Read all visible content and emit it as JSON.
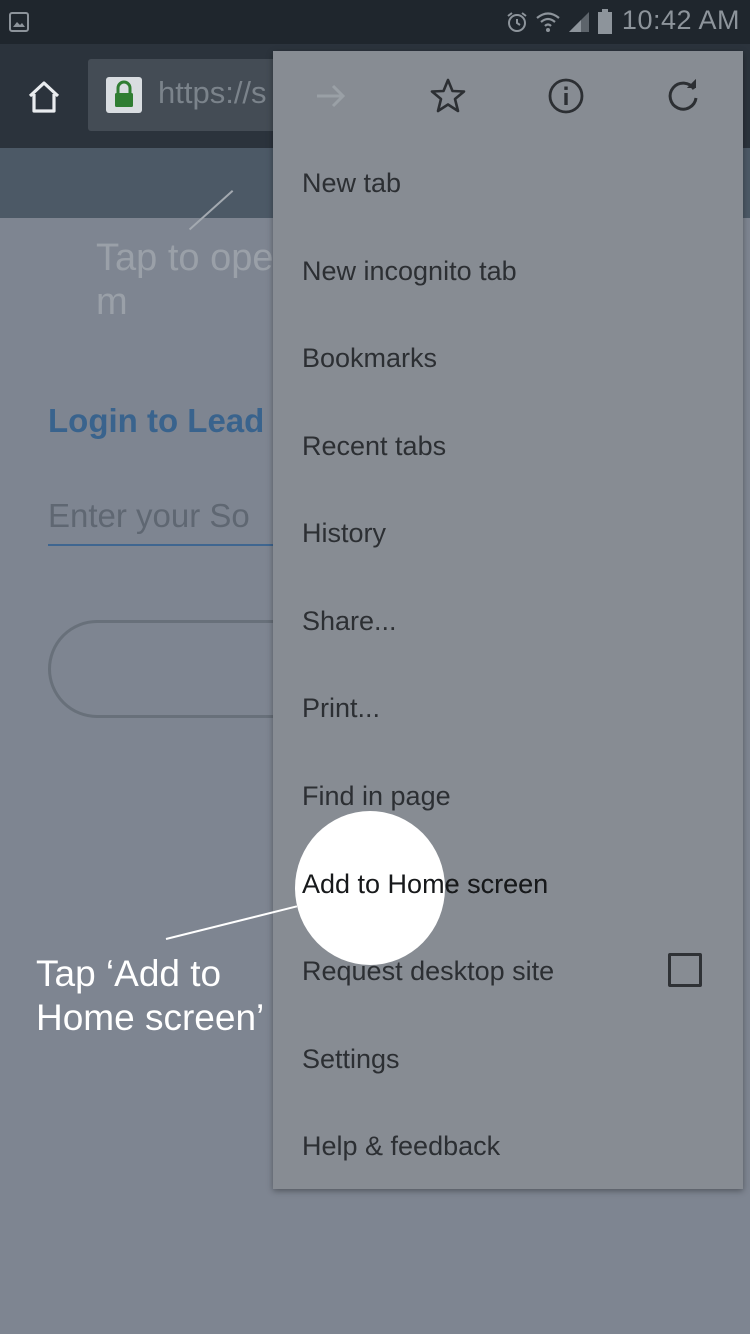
{
  "status_bar": {
    "time": "10:42 AM",
    "icons": [
      "gallery-icon",
      "alarm-icon",
      "wifi-icon",
      "signal-icon",
      "battery-icon"
    ]
  },
  "toolbar": {
    "url_text": "https://s"
  },
  "page": {
    "hint_text": "Tap to open chrome m",
    "login_title": "Login to Lead",
    "email_placeholder": "Enter your So"
  },
  "menu": {
    "toolbar_icons": [
      "forward-icon",
      "bookmark-star-icon",
      "info-icon",
      "refresh-icon"
    ],
    "items": [
      {
        "label": "New tab"
      },
      {
        "label": "New incognito tab"
      },
      {
        "label": "Bookmarks"
      },
      {
        "label": "Recent tabs"
      },
      {
        "label": "History"
      },
      {
        "label": "Share..."
      },
      {
        "label": "Print..."
      },
      {
        "label": "Find in page"
      },
      {
        "label": "Add to Home screen"
      },
      {
        "label": "Request desktop site",
        "checked": false
      },
      {
        "label": "Settings"
      },
      {
        "label": "Help & feedback"
      }
    ]
  },
  "annotation": {
    "text": "Tap ‘Add to Home screen’"
  },
  "colors": {
    "menu_bg": "#878c93",
    "accent_blue": "#39638d",
    "lock_green": "#2f7d32",
    "highlight": "#ffffff"
  }
}
